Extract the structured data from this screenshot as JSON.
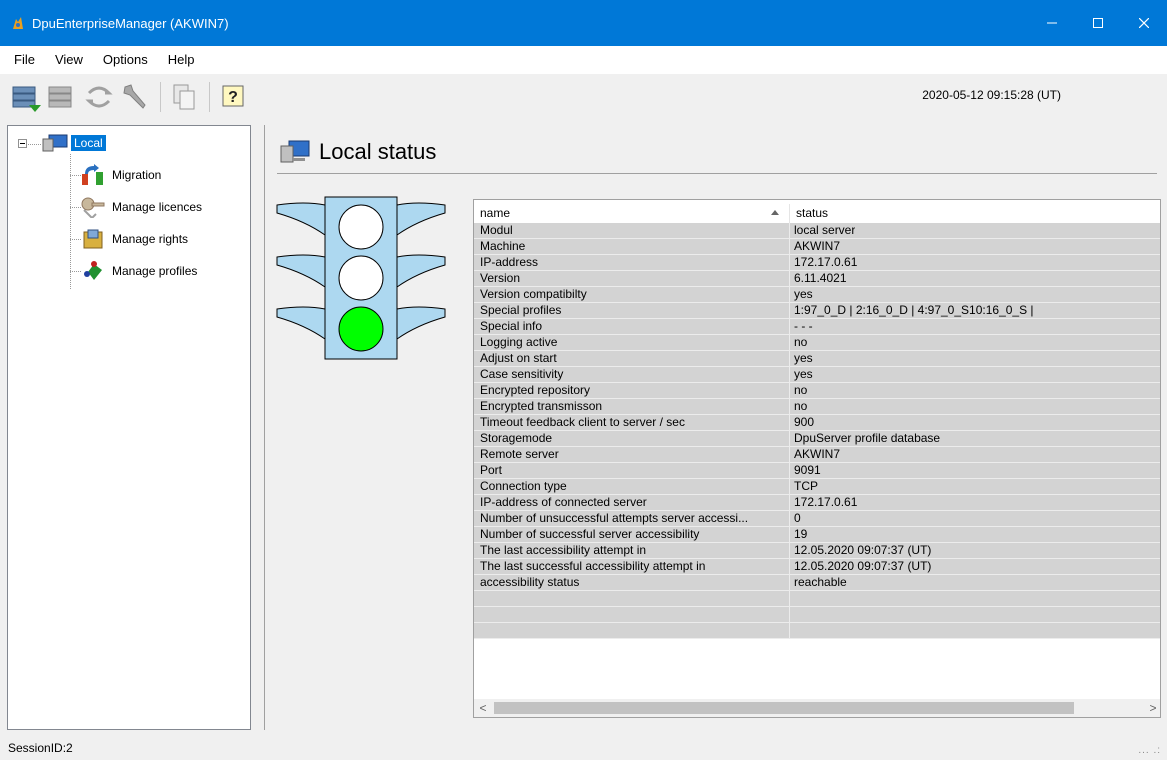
{
  "window": {
    "title": "DpuEnterpriseManager (AKWIN7)",
    "minimize_icon": "minimize-icon",
    "maximize_icon": "maximize-icon",
    "close_icon": "close-icon"
  },
  "menu": {
    "items": [
      "File",
      "View",
      "Options",
      "Help"
    ]
  },
  "toolbar": {
    "icons": [
      "server-connect-icon",
      "server-disconnect-icon",
      "refresh-icon",
      "tools-icon",
      "copy-icon",
      "help-icon"
    ],
    "datetime": "2020-05-12 09:15:28 (UT)"
  },
  "tree": {
    "root": "Local",
    "children": [
      {
        "label": "Migration",
        "icon": "migration-icon"
      },
      {
        "label": "Manage licences",
        "icon": "licence-icon"
      },
      {
        "label": "Manage rights",
        "icon": "rights-icon"
      },
      {
        "label": "Manage profiles",
        "icon": "profiles-icon"
      }
    ]
  },
  "content": {
    "title": "Local status",
    "traffic_light": {
      "active": "green",
      "colors": {
        "green": "#00ff00",
        "off": "#ffffff",
        "body": "#add8f0"
      }
    },
    "columns": [
      "name",
      "status"
    ],
    "rows": [
      [
        "Modul",
        "local server"
      ],
      [
        "Machine",
        "AKWIN7"
      ],
      [
        "IP-address",
        "172.17.0.61"
      ],
      [
        "Version",
        "6.11.4021"
      ],
      [
        "Version compatibilty",
        "yes"
      ],
      [
        "Special profiles",
        "1:97_0_D | 2:16_0_D | 4:97_0_S10:16_0_S |"
      ],
      [
        "Special info",
        "- - -"
      ],
      [
        "Logging active",
        "no"
      ],
      [
        "Adjust on start",
        "yes"
      ],
      [
        "Case sensitivity",
        "yes"
      ],
      [
        "Encrypted repository",
        "no"
      ],
      [
        "Encrypted transmisson",
        "no"
      ],
      [
        "Timeout feedback client to server / sec",
        "900"
      ],
      [
        "Storagemode",
        "DpuServer profile database"
      ],
      [
        "Remote server",
        "AKWIN7"
      ],
      [
        "Port",
        "9091"
      ],
      [
        "Connection type",
        "TCP"
      ],
      [
        "IP-address of connected server",
        "172.17.0.61"
      ],
      [
        "Number of unsuccessful attempts server accessi...",
        "0"
      ],
      [
        "Number of successful server accessibility",
        "19"
      ],
      [
        "The last accessibility attempt in",
        "12.05.2020 09:07:37 (UT)"
      ],
      [
        "The last successful accessibility attempt in",
        "12.05.2020 09:07:37 (UT)"
      ],
      [
        "accessibility status",
        "reachable"
      ],
      [
        "",
        ""
      ],
      [
        "",
        ""
      ],
      [
        "",
        ""
      ]
    ],
    "scroll_left": "<",
    "scroll_right": ">"
  },
  "statusbar": {
    "session": "SessionID:2",
    "grip": "... .:"
  }
}
